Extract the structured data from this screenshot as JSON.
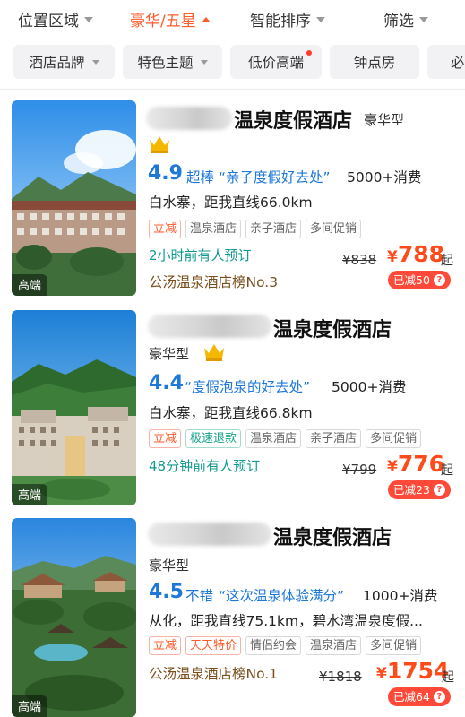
{
  "filters": [
    {
      "label": "位置区域",
      "active": false
    },
    {
      "label": "豪华/五星",
      "active": true
    },
    {
      "label": "智能排序",
      "active": false
    },
    {
      "label": "筛选",
      "active": false
    }
  ],
  "chips": [
    {
      "label": "酒店品牌",
      "dropdown": true
    },
    {
      "label": "特色主题",
      "dropdown": true
    },
    {
      "label": "低价高端",
      "dot": true
    },
    {
      "label": "钟点房"
    },
    {
      "label": "必"
    }
  ],
  "hotels": [
    {
      "name": "温泉度假酒店",
      "grade": "豪华型",
      "photo_tag": "高端",
      "score": "4.9",
      "level": "超棒",
      "quote": "“亲子度假好去处”",
      "consumption": "5000+消费",
      "location": "白水寨，距我直线66.0km",
      "tags": [
        {
          "text": "立减",
          "style": "red"
        },
        {
          "text": "温泉酒店",
          "style": "grey"
        },
        {
          "text": "亲子酒店",
          "style": "grey"
        },
        {
          "text": "多间促销",
          "style": "grey"
        }
      ],
      "booked": "2小时前有人预订",
      "rank": "公汤温泉酒店榜No.3",
      "old_price": "¥838",
      "currency": "¥",
      "price": "788",
      "price_suffix": "起",
      "discount": "已减50"
    },
    {
      "name": "温泉度假酒店",
      "grade": "豪华型",
      "photo_tag": "高端",
      "score": "4.4",
      "level": "",
      "quote": "“度假泡泉的好去处”",
      "consumption": "5000+消费",
      "location": "白水寨，距我直线66.8km",
      "tags": [
        {
          "text": "立减",
          "style": "red"
        },
        {
          "text": "极速退款",
          "style": "green"
        },
        {
          "text": "温泉酒店",
          "style": "grey"
        },
        {
          "text": "亲子酒店",
          "style": "grey"
        },
        {
          "text": "多间促销",
          "style": "grey"
        }
      ],
      "booked": "48分钟前有人预订",
      "rank": "",
      "old_price": "¥799",
      "currency": "¥",
      "price": "776",
      "price_suffix": "起",
      "discount": "已减23"
    },
    {
      "name": "温泉度假酒店",
      "grade": "豪华型",
      "photo_tag": "高端",
      "score": "4.5",
      "level": "不错",
      "quote": "“这次温泉体验满分”",
      "consumption": "1000+消费",
      "location": "从化，距我直线75.1km，碧水湾温泉度假...",
      "tags": [
        {
          "text": "立减",
          "style": "red"
        },
        {
          "text": "天天特价",
          "style": "red"
        },
        {
          "text": "情侣约会",
          "style": "grey"
        },
        {
          "text": "温泉酒店",
          "style": "grey"
        },
        {
          "text": "多间促销",
          "style": "grey"
        }
      ],
      "booked": "",
      "rank": "公汤温泉酒店榜No.1",
      "old_price": "¥1818",
      "currency": "¥",
      "price": "1754",
      "price_suffix": "起",
      "discount": "已减64"
    }
  ],
  "colors": {
    "accent": "#ff5a2a",
    "price": "#ff4a1a",
    "score_blue": "#1e78d8",
    "booked_teal": "#0f9b8e",
    "rank_brown": "#7b4e1c"
  }
}
